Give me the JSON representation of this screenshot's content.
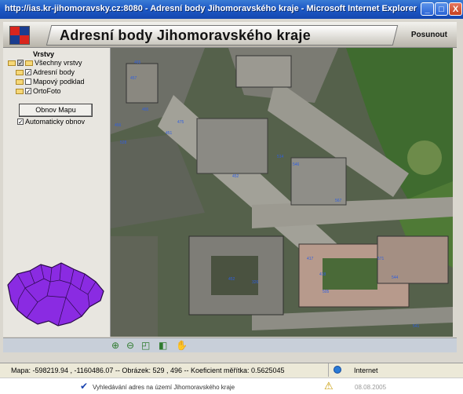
{
  "window": {
    "title": "http://ias.kr-jihomoravsky.cz:8080 - Adresní body Jihomoravského kraje - Microsoft Internet Explorer",
    "minimize": "_",
    "maximize": "□",
    "close": "X"
  },
  "header": {
    "title": "Adresní body Jihomoravského kraje",
    "posunout": "Posunout"
  },
  "layers": {
    "heading": "Vrstvy",
    "all": "Všechny vrstvy",
    "items": [
      {
        "label": "Adresní body",
        "checked": true
      },
      {
        "label": "Mapový podklad",
        "checked": false
      },
      {
        "label": "OrtoFoto",
        "checked": true
      }
    ]
  },
  "controls": {
    "refresh_button": "Obnov Mapu",
    "auto_refresh_label": "Automaticky obnov",
    "auto_refresh_checked": true
  },
  "map": {
    "address_labels": [
      "465",
      "457",
      "455",
      "456",
      "451",
      "475",
      "528",
      "452",
      "514",
      "546",
      "567",
      "417",
      "452",
      "418",
      "505",
      "326",
      "571",
      "544",
      "541"
    ]
  },
  "toolbar": {
    "tools": [
      "zoom-in",
      "zoom-out",
      "zoom-extent",
      "zoom-previous",
      "pan"
    ]
  },
  "status": {
    "text": "Mapa: -598219.94 , -1160486.07 -- Obrázek: 529 , 496 -- Koeficient měřítka: 0.5625045",
    "zone": "Internet"
  },
  "taskbar": {
    "text": "Vyhledávání adres na území Jihomoravského kraje",
    "date": "08.08.2005"
  },
  "colors": {
    "titlebar": "#1c58c5",
    "minimap_region": "#8a2be2",
    "address_label": "#2f5fe0"
  }
}
